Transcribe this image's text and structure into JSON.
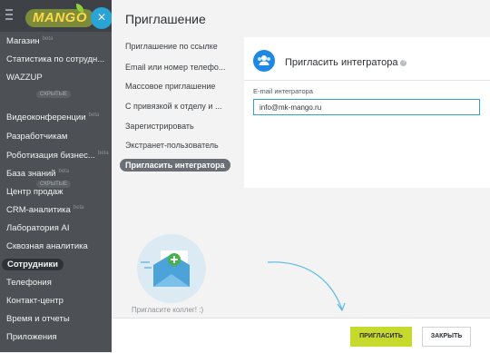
{
  "sidebar": {
    "logo": "MANGO",
    "close_glyph": "×",
    "items": [
      {
        "label": "Магазин",
        "badge": "beta"
      },
      {
        "label": "Статистика по сотрудн...",
        "badge": ""
      },
      {
        "label": "WAZZUP",
        "badge": ""
      },
      {
        "label": "Видеоконференции",
        "badge": "beta"
      },
      {
        "label": "Разработчикам",
        "badge": ""
      },
      {
        "label": "Роботизация бизнес...",
        "badge": "beta"
      },
      {
        "label": "База знаний",
        "badge": "beta"
      },
      {
        "label": "Центр продаж",
        "badge": ""
      },
      {
        "label": "CRM-аналитика",
        "badge": "beta"
      },
      {
        "label": "Лаборатория AI",
        "badge": ""
      },
      {
        "label": "Сквозная аналитика",
        "badge": ""
      },
      {
        "label": "Сотрудники",
        "badge": ""
      },
      {
        "label": "Телефония",
        "badge": ""
      },
      {
        "label": "Контакт-центр",
        "badge": ""
      },
      {
        "label": "Время и отчеты",
        "badge": ""
      },
      {
        "label": "Приложения",
        "badge": ""
      }
    ],
    "sep1": "СКРЫТЫЕ",
    "sep2": "СКРЫТЫЕ"
  },
  "panel": {
    "title": "Приглашение",
    "nav": [
      "Приглашение по ссылке",
      "Email или номер телефо...",
      "Массовое приглашение",
      "С привязкой к отделу и ...",
      "Зарегистрировать",
      "Экстранет-пользователь",
      "Пригласить интегратора"
    ]
  },
  "card": {
    "title": "Пригласить интегратора",
    "help": "?",
    "email_label": "E-mail интегратора",
    "email_value": "info@mk-mango.ru"
  },
  "illustration": {
    "caption": "Пригласите коллег! :)",
    "plus": "+"
  },
  "footer": {
    "invite_label": "ПРИГЛАСИТЬ",
    "close_label": "ЗАКРЫТЬ"
  },
  "colors": {
    "accent_blue": "#2aa4d6",
    "invite_green": "#c6da2d",
    "sidebar_bg": "#4d5155"
  }
}
